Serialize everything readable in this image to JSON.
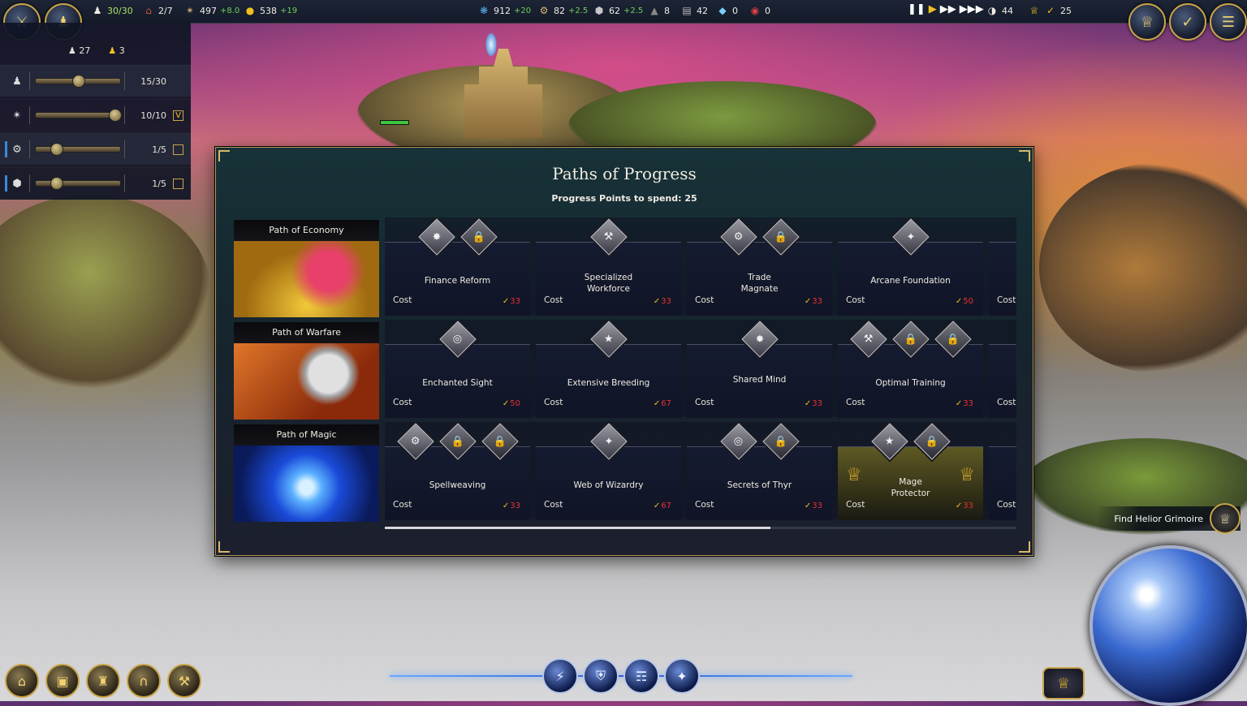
{
  "topbar": {
    "population": "30/30",
    "housing": "2/7",
    "food": "497",
    "food_delta": "+8.0",
    "gold": "538",
    "gold_delta": "+19",
    "mana": "912",
    "mana_delta": "+20",
    "materials": "82",
    "materials_delta": "+2.5",
    "stone": "62",
    "stone_delta": "+2.5",
    "ore": "8",
    "iron": "42",
    "gems": "0",
    "special": "0",
    "day_value": "44",
    "progress_points": "25",
    "icons": {
      "population": "people-icon",
      "housing": "house-icon",
      "food": "bread-icon",
      "gold": "coin-icon",
      "mana": "mana-swirl-icon",
      "materials": "gears-icon",
      "stone": "stone-icon",
      "ore": "ore-icon",
      "iron": "iron-bar-icon",
      "gems": "diamond-icon",
      "special": "target-icon"
    }
  },
  "left_panel": {
    "workers": "27",
    "idle": "3",
    "rows": [
      {
        "icon": "worker-icon",
        "value": "15/30",
        "fill": 0.5
      },
      {
        "icon": "bread-icon",
        "value": "10/10",
        "fill": 1.0,
        "checked": "V"
      },
      {
        "icon": "gears-icon",
        "value": "1/5",
        "fill": 0.2
      },
      {
        "icon": "stone-icon",
        "value": "1/5",
        "fill": 0.2
      }
    ]
  },
  "dialog": {
    "title": "Paths of Progress",
    "subtitle": "Progress Points to spend: 25",
    "paths": [
      {
        "label": "Path of Economy",
        "art": "gold-treasure-art"
      },
      {
        "label": "Path of Warfare",
        "art": "helmet-sword-art"
      },
      {
        "label": "Path of Magic",
        "art": "spellbook-art"
      }
    ],
    "cost_label": "Cost",
    "rows": [
      [
        {
          "name": "Finance Reform",
          "cost": "33",
          "icons": 2
        },
        {
          "name": "Specialized Workforce",
          "cost": "33",
          "icons": 1
        },
        {
          "name": "Trade Magnate",
          "cost": "33",
          "icons": 2
        },
        {
          "name": "Arcane Foundation",
          "cost": "50",
          "icons": 1
        }
      ],
      [
        {
          "name": "Enchanted Sight",
          "cost": "50",
          "icons": 1
        },
        {
          "name": "Extensive Breeding",
          "cost": "67",
          "icons": 1
        },
        {
          "name": "Shared Mind",
          "cost": "33",
          "icons": 1
        },
        {
          "name": "Optimal Training",
          "cost": "33",
          "icons": 3
        }
      ],
      [
        {
          "name": "Spellweaving",
          "cost": "33",
          "icons": 3
        },
        {
          "name": "Web of Wizardry",
          "cost": "67",
          "icons": 1
        },
        {
          "name": "Secrets of Thyr",
          "cost": "33",
          "icons": 2
        },
        {
          "name": "Mage Protector",
          "cost": "33",
          "icons": 2,
          "highlighted": true
        }
      ]
    ],
    "scroll_fraction": 0.61
  },
  "quest": {
    "label": "Find Helior Grimoire"
  },
  "colors": {
    "accent_gold": "#c9a54a",
    "cost_red": "#e83030",
    "delta_green": "#6fcf5a"
  }
}
